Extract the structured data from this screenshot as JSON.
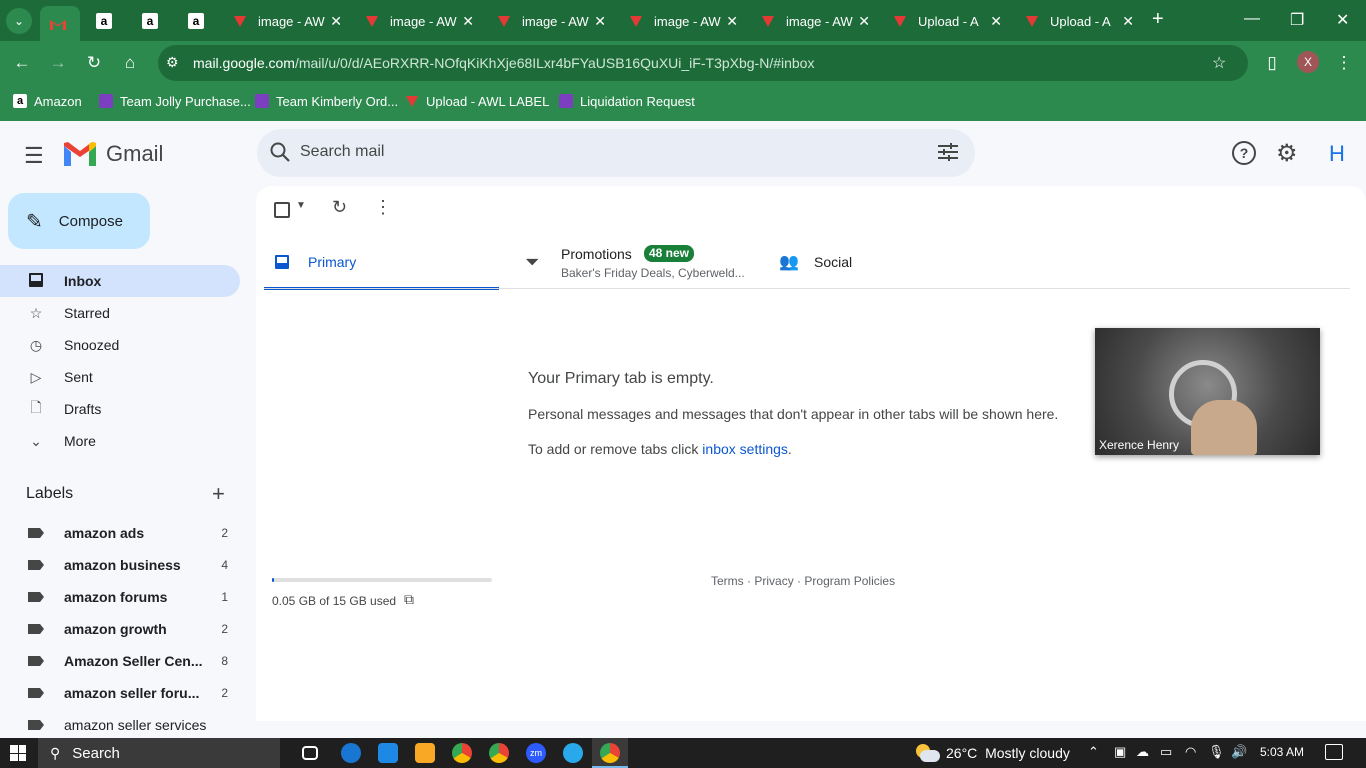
{
  "browser": {
    "tabs": [
      {
        "title": "",
        "icon": "gmail-icon"
      },
      {
        "title": "",
        "icon": "amazon-icon"
      },
      {
        "title": "",
        "icon": "amazon-icon"
      },
      {
        "title": "",
        "icon": "amazon-icon"
      },
      {
        "title": "image - AW",
        "icon": "awl-icon"
      },
      {
        "title": "image - AW",
        "icon": "awl-icon"
      },
      {
        "title": "image - AW",
        "icon": "awl-icon"
      },
      {
        "title": "image - AW",
        "icon": "awl-icon"
      },
      {
        "title": "image - AW",
        "icon": "awl-icon"
      },
      {
        "title": "Upload - A",
        "icon": "awl-icon"
      },
      {
        "title": "Upload - A",
        "icon": "awl-icon"
      }
    ],
    "url_host": "mail.google.com",
    "url_path": "/mail/u/0/d/AEoRXRR-NOfqKiKhXje68ILxr4bFYaUSB16QuXUi_iF-T3pXbg-N/#inbox",
    "profile_initial": "X",
    "bookmarks": [
      "Amazon",
      "Team Jolly Purchase...",
      "Team Kimberly Ord...",
      "Upload - AWL LABEL",
      "Liquidation Request"
    ]
  },
  "gmail": {
    "brand": "Gmail",
    "search_placeholder": "Search mail",
    "account_initial": "H",
    "compose_label": "Compose",
    "nav": [
      {
        "label": "Inbox",
        "icon": "inbox-icon"
      },
      {
        "label": "Starred",
        "icon": "star-icon"
      },
      {
        "label": "Snoozed",
        "icon": "clock-icon"
      },
      {
        "label": "Sent",
        "icon": "send-icon"
      },
      {
        "label": "Drafts",
        "icon": "draft-icon"
      },
      {
        "label": "More",
        "icon": "chevron-down-icon"
      }
    ],
    "labels_heading": "Labels",
    "labels": [
      {
        "name": "amazon ads",
        "count": "2",
        "bold": true
      },
      {
        "name": "amazon business",
        "count": "4",
        "bold": true
      },
      {
        "name": "amazon forums",
        "count": "1",
        "bold": true
      },
      {
        "name": "amazon growth",
        "count": "2",
        "bold": true
      },
      {
        "name": "Amazon Seller Cen...",
        "count": "8",
        "bold": true
      },
      {
        "name": "amazon seller foru...",
        "count": "2",
        "bold": true
      },
      {
        "name": "amazon seller services",
        "count": "",
        "bold": false
      }
    ],
    "tabs": {
      "primary": "Primary",
      "promotions": "Promotions",
      "promotions_badge": "48 new",
      "promotions_snippet": "Baker's Friday Deals, Cyberweld...",
      "social": "Social"
    },
    "empty": {
      "title": "Your Primary tab is empty.",
      "line1": "Personal messages and messages that don't appear in other tabs will be shown here.",
      "line2_prefix": "To add or remove tabs click ",
      "line2_link": "inbox settings",
      "line2_suffix": "."
    },
    "storage": {
      "used_text": "0.05 GB of 15 GB used",
      "fraction": 0.003
    },
    "footer": {
      "terms": "Terms",
      "sep": "·",
      "privacy": "Privacy",
      "policies": "Program Policies"
    },
    "video": {
      "name": "Xerence Henry"
    }
  },
  "taskbar": {
    "search": "Search",
    "weather_temp": "26°C",
    "weather_text": "Mostly cloudy",
    "time": "5:03 AM"
  },
  "colors": {
    "accent_green": "#2d8a4e",
    "selected_blue": "#d3e3fd",
    "link_blue": "#0b57d0",
    "badge_green": "#188038"
  }
}
